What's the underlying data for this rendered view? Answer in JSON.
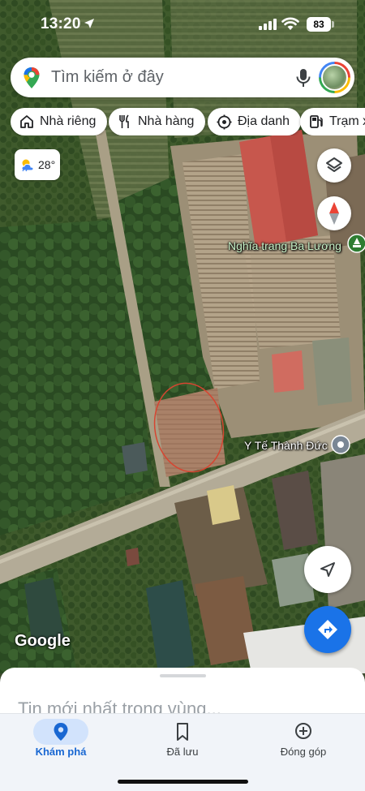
{
  "status_bar": {
    "time": "13:20",
    "battery": "83"
  },
  "search": {
    "placeholder": "Tìm kiếm ở đây"
  },
  "chips": [
    {
      "label": "Nhà riêng",
      "icon": "home-icon"
    },
    {
      "label": "Nhà hàng",
      "icon": "restaurant-icon"
    },
    {
      "label": "Địa danh",
      "icon": "landmark-icon"
    },
    {
      "label": "Trạm x",
      "icon": "gas-station-icon"
    }
  ],
  "weather": {
    "temperature": "28°",
    "icon": "partly-cloudy-icon"
  },
  "map": {
    "labels": {
      "cemetery": "Nghĩa trang Ba Lương",
      "clinic": "Y Tế Thành Đức"
    },
    "attribution": "Google"
  },
  "sheet": {
    "title": "Tin mới nhất trong vùng..."
  },
  "nav": {
    "items": [
      {
        "label": "Khám phá",
        "icon": "explore-pin-icon",
        "active": true
      },
      {
        "label": "Đã lưu",
        "icon": "bookmark-icon",
        "active": false
      },
      {
        "label": "Đóng góp",
        "icon": "add-circle-icon",
        "active": false
      }
    ]
  },
  "colors": {
    "accent": "#1a73e8",
    "active_nav": "#1967d2",
    "active_pill": "#d2e3fc"
  }
}
